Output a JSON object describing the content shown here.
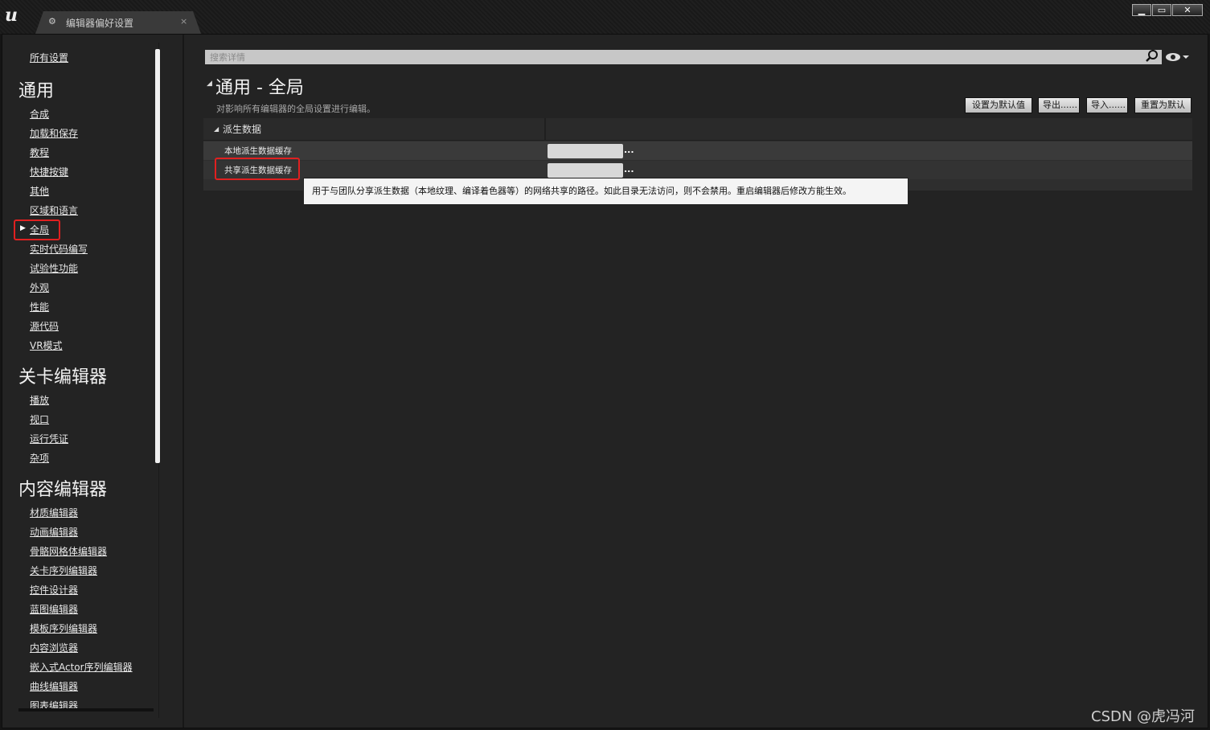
{
  "window": {
    "tab_title": "编辑器偏好设置",
    "tab_icon": "ue-tab-icon",
    "tab_close": "×",
    "min": "▁",
    "max": "▭",
    "close": "✕"
  },
  "sidebar": {
    "all_settings": "所有设置",
    "sections": [
      {
        "heading": "通用",
        "items": [
          "合成",
          "加载和保存",
          "教程",
          "快捷按键",
          "其他",
          "区域和语言",
          "全局",
          "实时代码编写",
          "试验性功能",
          "外观",
          "性能",
          "源代码",
          "VR模式"
        ]
      },
      {
        "heading": "关卡编辑器",
        "items": [
          "播放",
          "视口",
          "运行凭证",
          "杂项"
        ]
      },
      {
        "heading": "内容编辑器",
        "items": [
          "材质编辑器",
          "动画编辑器",
          "骨骼网格体编辑器",
          "关卡序列编辑器",
          "控件设计器",
          "蓝图编辑器",
          "模板序列编辑器",
          "内容浏览器",
          "嵌入式Actor序列编辑器",
          "曲线编辑器",
          "图表编辑器"
        ]
      }
    ],
    "selected_item": "全局"
  },
  "search": {
    "placeholder": "搜索详情"
  },
  "page": {
    "title": "通用 - 全局",
    "description": "对影响所有编辑器的全局设置进行编辑。",
    "buttons": {
      "set_default": "设置为默认值",
      "export": "导出......",
      "import": "导入......",
      "reset": "重置为默认"
    }
  },
  "category": {
    "name": "派生数据",
    "properties": [
      {
        "label": "本地派生数据缓存",
        "value": "",
        "browse": "..."
      },
      {
        "label": "共享派生数据缓存",
        "value": "",
        "browse": "..."
      }
    ]
  },
  "tooltip": "用于与团队分享派生数据（本地纹理、编译着色器等）的网络共享的路径。如此目录无法访问，则不会禁用。重启编辑器后修改方能生效。",
  "watermark": "CSDN @虎冯河",
  "colors": {
    "highlight": "#e02020",
    "background": "#232323"
  }
}
